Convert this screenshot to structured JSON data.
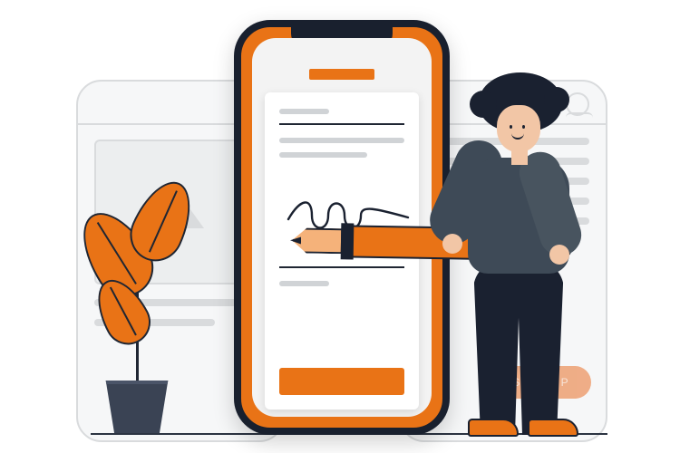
{
  "illustration": {
    "concept": "mobile-sign-up-illustration",
    "background_button_label": "SIGN UP",
    "colors": {
      "accent": "#e97316",
      "ink": "#19202e",
      "muted": "#d9dbdd",
      "skin": "#f2c6a6",
      "shirt": "#3e4a57"
    },
    "icons": {
      "image_placeholder": "image-placeholder-icon",
      "user": "user-avatar-icon",
      "signature": "signature-scribble-icon",
      "plant": "potted-plant-icon",
      "pen": "large-pen-icon"
    }
  }
}
